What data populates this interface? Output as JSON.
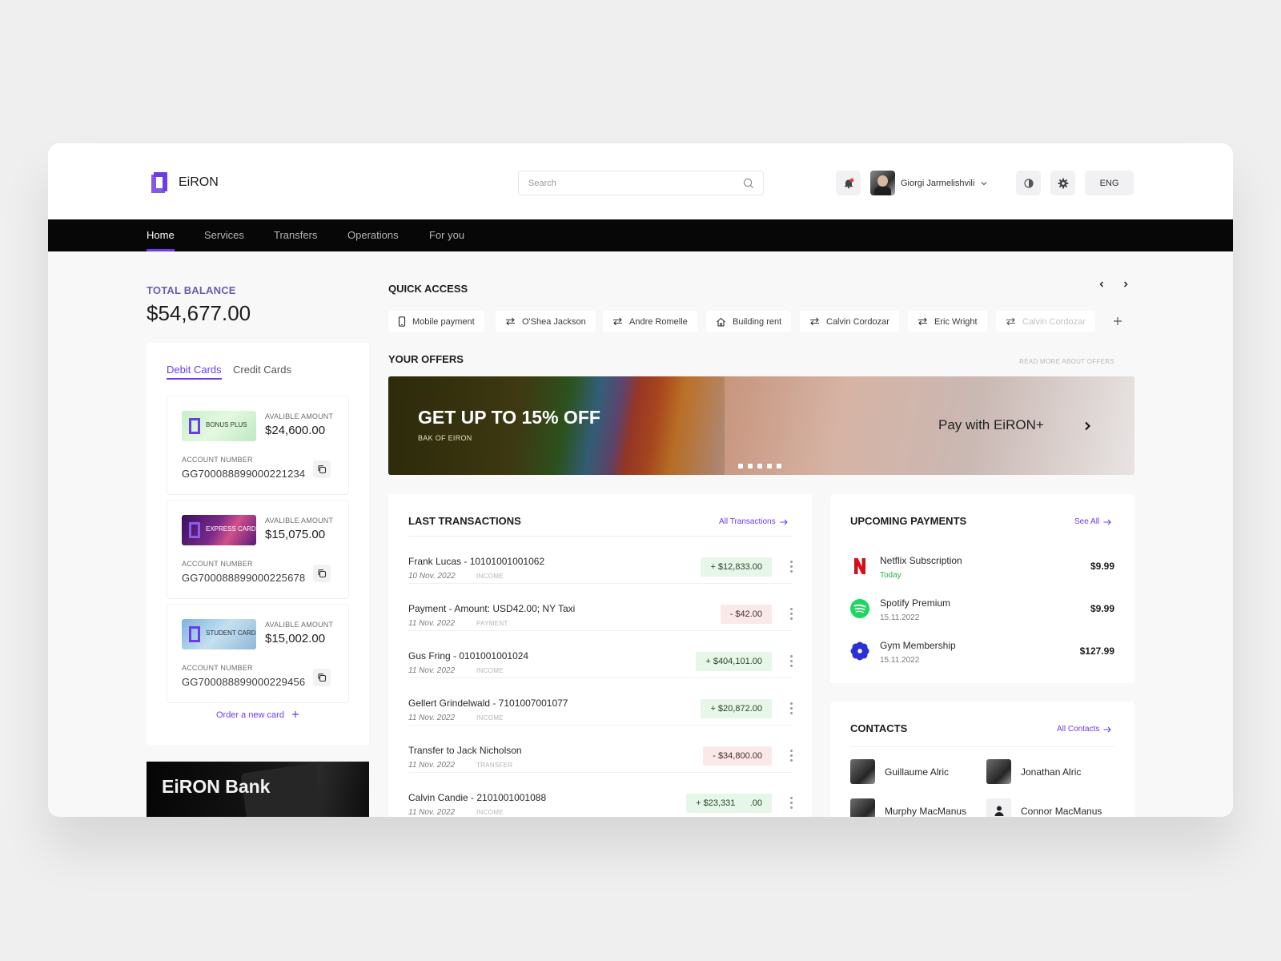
{
  "app": {
    "name": "EiRON",
    "brand_color": "#6d3ce8"
  },
  "header": {
    "search_placeholder": "Search",
    "user_name": "Giorgi Jarmelishvili",
    "language": "ENG"
  },
  "nav": {
    "items": [
      {
        "label": "Home",
        "active": true
      },
      {
        "label": "Services",
        "active": false
      },
      {
        "label": "Transfers",
        "active": false
      },
      {
        "label": "Operations",
        "active": false
      },
      {
        "label": "For you",
        "active": false
      }
    ]
  },
  "balance": {
    "label": "TOTAL BALANCE",
    "value": "$54,677.00"
  },
  "cards": {
    "tabs": [
      {
        "label": "Debit Cards",
        "active": true
      },
      {
        "label": "Credit Cards",
        "active": false
      }
    ],
    "items": [
      {
        "name": "BONUS PLUS",
        "available_label": "AVALIBLE AMOUNT",
        "available": "$24,600.00",
        "account_label": "ACCOUNT NUMBER",
        "account": "GG700088899000221234"
      },
      {
        "name": "EXPRESS CARD",
        "available_label": "AVALIBLE AMOUNT",
        "available": "$15,075.00",
        "account_label": "ACCOUNT NUMBER",
        "account": "GG700088899000225678"
      },
      {
        "name": "STUDENT CARD",
        "available_label": "AVALIBLE AMOUNT",
        "available": "$15,002.00",
        "account_label": "ACCOUNT NUMBER",
        "account": "GG700088899000229456"
      }
    ],
    "order_label": "Order a new card"
  },
  "promo": {
    "title": "EiRON Bank"
  },
  "quick_access": {
    "title": "QUICK ACCESS",
    "items": [
      {
        "label": "Mobile payment",
        "icon": "phone-icon"
      },
      {
        "label": "O'Shea Jackson",
        "icon": "transfer-icon"
      },
      {
        "label": "Andre Romelle",
        "icon": "transfer-icon"
      },
      {
        "label": "Building rent",
        "icon": "home-icon"
      },
      {
        "label": "Calvin Cordozar",
        "icon": "transfer-icon"
      },
      {
        "label": "Eric Wright",
        "icon": "transfer-icon"
      },
      {
        "label": "Calvin Cordozar",
        "icon": "transfer-icon"
      }
    ]
  },
  "offers": {
    "title": "YOUR OFFERS",
    "link": "READ MORE ABOUT OFFERS",
    "banner_headline": "GET UP TO 15% OFF",
    "banner_sub": "BAK OF EIRON",
    "banner_cta": "Pay with EiRON+",
    "slide_count": 5
  },
  "transactions": {
    "title": "LAST TRANSACTIONS",
    "link": "All Transactions",
    "rows": [
      {
        "name": "Frank Lucas - 10101001001062",
        "date": "10 Nov. 2022",
        "type": "INCOME",
        "amount": "+ $12,833.00",
        "direction": "in"
      },
      {
        "name": "Payment - Amount: USD42.00; NY Taxi",
        "date": "11 Nov. 2022",
        "type": "PAYMENT",
        "amount": "- $42.00",
        "direction": "out"
      },
      {
        "name": "Gus Fring - 0101001001024",
        "date": "11 Nov. 2022",
        "type": "INCOME",
        "amount": "+ $404,101.00",
        "direction": "in"
      },
      {
        "name": "Gellert Grindelwald - 7101007001077",
        "date": "11 Nov. 2022",
        "type": "INCOME",
        "amount": "+ $20,872.00",
        "direction": "in"
      },
      {
        "name": "Transfer to Jack Nicholson",
        "date": "11 Nov. 2022",
        "type": "TRANSFER",
        "amount": "- $34,800.00",
        "direction": "out"
      },
      {
        "name": "Calvin Candie - 2101001001088",
        "date": "11 Nov. 2022",
        "type": "INCOME",
        "amount": "+ $23,331      .00",
        "direction": "in"
      }
    ]
  },
  "upcoming": {
    "title": "UPCOMING PAYMENTS",
    "link": "See All",
    "items": [
      {
        "name": "Netflix Subscription",
        "date": "Today",
        "amount": "$9.99",
        "icon": "netflix-icon"
      },
      {
        "name": "Spotify Premium",
        "date": "15.11.2022",
        "amount": "$9.99",
        "icon": "spotify-icon"
      },
      {
        "name": "Gym Membership",
        "date": "15.11.2022",
        "amount": "$127.99",
        "icon": "gym-icon"
      }
    ]
  },
  "contacts": {
    "title": "CONTACTS",
    "link": "All Contacts",
    "items": [
      {
        "name": "Guillaume Alric"
      },
      {
        "name": "Jonathan Alric"
      },
      {
        "name": "Murphy MacManus"
      },
      {
        "name": "Connor MacManus"
      }
    ]
  }
}
